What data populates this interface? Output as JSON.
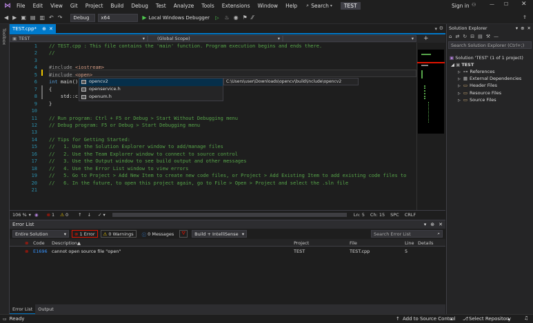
{
  "menu": [
    "File",
    "Edit",
    "View",
    "Git",
    "Project",
    "Build",
    "Debug",
    "Test",
    "Analyze",
    "Tools",
    "Extensions",
    "Window",
    "Help"
  ],
  "search_label": "Search",
  "solution_badge": "TEST",
  "sign_in": "Sign in",
  "toolbar": {
    "config": "Debug",
    "platform": "x64",
    "run_label": "Local Windows Debugger"
  },
  "toolbox_label": "Toolbox",
  "doc_tab": "TEST.cpp*",
  "nav": {
    "project": "TEST",
    "scope": "(Global Scope)"
  },
  "code": {
    "line_numbers": [
      "1",
      "2",
      "3",
      "4",
      "5",
      "6",
      "7",
      "8",
      "9",
      "10",
      "11",
      "12",
      "13",
      "14",
      "15",
      "16",
      "17",
      "18",
      "19",
      "20",
      "21"
    ],
    "lines": [
      [
        {
          "t": "// TEST.cpp : This file contains the 'main' function. Program execution begins and ends there.",
          "c": "cmt"
        }
      ],
      [
        {
          "t": "//",
          "c": "cmt"
        }
      ],
      [],
      [
        {
          "t": "#include ",
          "c": "pp"
        },
        {
          "t": "<iostream>",
          "c": "inc"
        }
      ],
      [
        {
          "t": "#include ",
          "c": "pp"
        },
        {
          "t": "<open>",
          "c": "inc"
        }
      ],
      [
        {
          "t": "int",
          "c": "kw"
        },
        {
          "t": " main()",
          "c": ""
        }
      ],
      [
        {
          "t": "{",
          "c": ""
        }
      ],
      [
        {
          "t": "    std::c",
          "c": ""
        }
      ],
      [
        {
          "t": "}",
          "c": ""
        }
      ],
      [],
      [
        {
          "t": "// Run program: Ctrl + F5 or Debug > Start Without Debugging menu",
          "c": "cmt"
        }
      ],
      [
        {
          "t": "// Debug program: F5 or Debug > Start Debugging menu",
          "c": "cmt"
        }
      ],
      [],
      [
        {
          "t": "// Tips for Getting Started:",
          "c": "cmt"
        }
      ],
      [
        {
          "t": "//   1. Use the Solution Explorer window to add/manage files",
          "c": "cmt"
        }
      ],
      [
        {
          "t": "//   2. Use the Team Explorer window to connect to source control",
          "c": "cmt"
        }
      ],
      [
        {
          "t": "//   3. Use the Output window to see build output and other messages",
          "c": "cmt"
        }
      ],
      [
        {
          "t": "//   4. Use the Error List window to view errors",
          "c": "cmt"
        }
      ],
      [
        {
          "t": "//   5. Go to Project > Add New Item to create new code files, or Project > Add Existing Item to add existing code files to",
          "c": "cmt"
        }
      ],
      [
        {
          "t": "//   6. In the future, to open this project again, go to File > Open > Project and select the .sln file",
          "c": "cmt"
        }
      ],
      []
    ]
  },
  "autocomplete": {
    "items": [
      "opencv2",
      "openservice.h",
      "openum.h"
    ],
    "tooltip": "C:\\Users\\user\\Downloads\\opencv\\build\\include\\opencv2"
  },
  "editor_status": {
    "zoom": "106 %",
    "errors": "1",
    "warnings": "0",
    "ln": "Ln: 5",
    "ch": "Ch: 15",
    "spc": "SPC",
    "crlf": "CRLF"
  },
  "error_list": {
    "title": "Error List",
    "scope": "Entire Solution",
    "errors_btn": "1 Error",
    "warnings_btn": "0 Warnings",
    "messages_btn": "0 Messages",
    "build_filter": "Build + IntelliSense",
    "search_placeholder": "Search Error List",
    "columns": {
      "code": "Code",
      "description": "Description",
      "project": "Project",
      "file": "File",
      "line": "Line",
      "details": "Details"
    },
    "rows": [
      {
        "code": "E1696",
        "description": "cannot open source file \"open\"",
        "project": "TEST",
        "file": "TEST.cpp",
        "line": "5"
      }
    ]
  },
  "panel_tabs": [
    "Error List",
    "Output"
  ],
  "solution_explorer": {
    "title": "Solution Explorer",
    "search_placeholder": "Search Solution Explorer (Ctrl+;)",
    "solution": "Solution 'TEST' (1 of 1 project)",
    "project": "TEST",
    "items": [
      "References",
      "External Dependencies",
      "Header Files",
      "Resource Files",
      "Source Files"
    ]
  },
  "status": {
    "ready": "Ready",
    "source_control": "Add to Source Control",
    "repository": "Select Repository"
  },
  "colors": {
    "accent": "#007acc",
    "error": "#e51400",
    "comment": "#57a64a",
    "keyword": "#569cd6",
    "string": "#d69d85"
  }
}
